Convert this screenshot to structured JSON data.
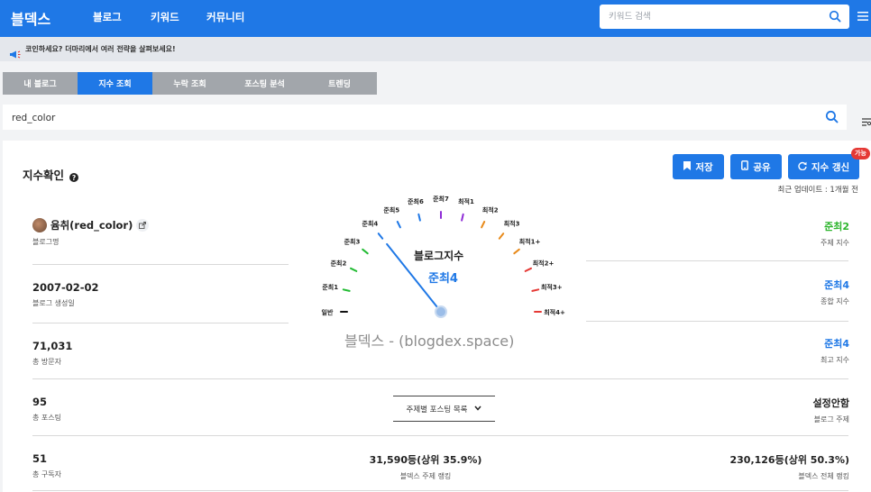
{
  "nav": {
    "logo": "블덱스",
    "links": [
      "블로그",
      "키워드",
      "커뮤니티"
    ],
    "search_placeholder": "키워드 검색"
  },
  "notice": {
    "text": "코인하세요? 더마리에서 여러 전략을 살펴보세요!"
  },
  "tabs": [
    "내 블로그",
    "지수 조회",
    "누락 조회",
    "포스팅 분석",
    "트렌딩"
  ],
  "active_tab": 1,
  "blog_search": {
    "value": "red_color"
  },
  "section": {
    "title": "지수확인",
    "buttons": {
      "save": "저장",
      "share": "공유",
      "refresh": "지수 갱신"
    },
    "refresh_badge": "가능",
    "update_text": "최근 업데이트 : 1개월 전"
  },
  "blog": {
    "name": "윰취(red_color)",
    "name_label": "블로그명",
    "created": "2007-02-02",
    "created_label": "블로그 생성일",
    "visitors": "71,031",
    "visitors_label": "총 방문자",
    "posts": "95",
    "posts_label": "총 포스팅",
    "subscribers": "51",
    "subscribers_label": "총 구독자"
  },
  "indices": {
    "topic_index": "준최2",
    "topic_index_label": "주제 지수",
    "overall_index": "준최4",
    "overall_index_label": "종합 지수",
    "max_index": "준최4",
    "max_index_label": "최고 지수",
    "blog_topic": "설정안함",
    "blog_topic_label": "블로그 주제",
    "overall_rank": "230,126등(상위 50.3%)",
    "overall_rank_label": "블덱스 전체 랭킹"
  },
  "center": {
    "dropdown_label": "주제별 포스팅 목록",
    "topic_rank": "31,590등(상위 35.9%)",
    "topic_rank_label": "블덱스 주제 랭킹"
  },
  "gauge": {
    "title": "블로그지수",
    "value": "준최4",
    "watermark": "블덱스 - (blogdex.space)",
    "levels": [
      "일반",
      "준최1",
      "준최2",
      "준최3",
      "준최4",
      "준최5",
      "준최6",
      "준최7",
      "최적1",
      "최적2",
      "최적3",
      "최적1+",
      "최적2+",
      "최적3+",
      "최적4+"
    ],
    "current_level_index": 4
  },
  "colors": {
    "accent": "#1f78e6",
    "topic_index": "#2db52d",
    "badge": "#e53935"
  }
}
